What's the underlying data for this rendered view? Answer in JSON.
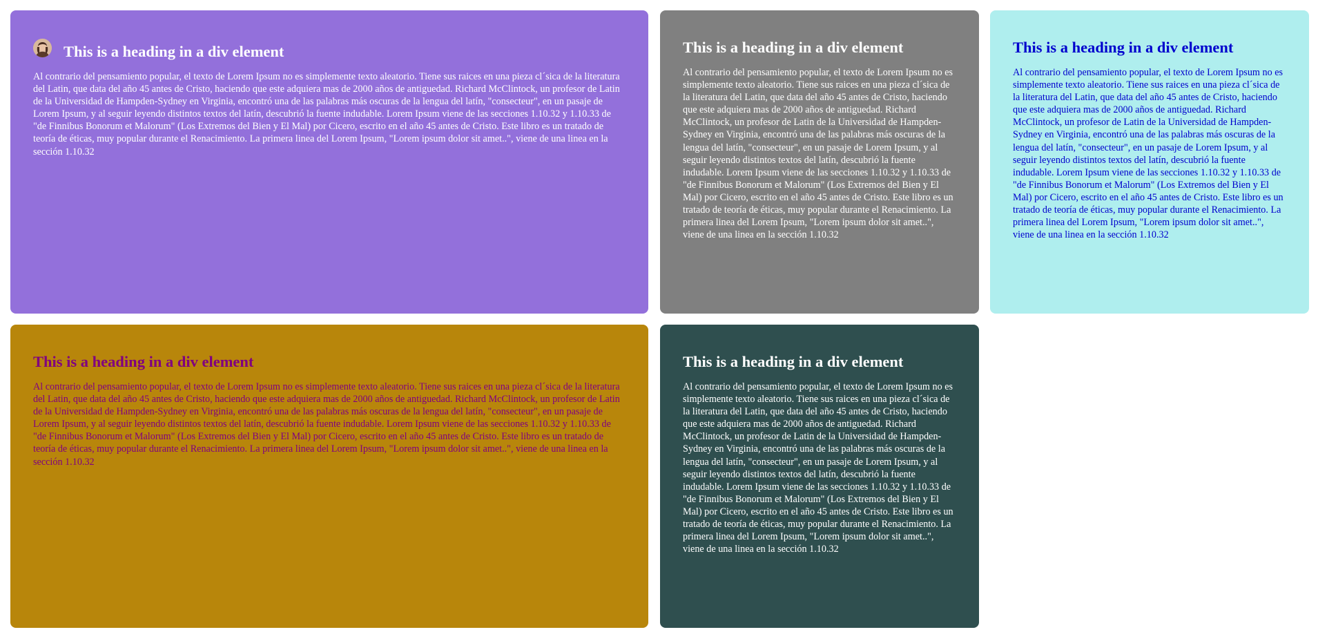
{
  "cards": [
    {
      "heading": "This is a heading in a div element",
      "body": "Al contrario del pensamiento popular, el texto de Lorem Ipsum no es simplemente texto aleatorio. Tiene sus raices en una pieza cl´sica de la literatura del Latin, que data del año 45 antes de Cristo, haciendo que este adquiera mas de 2000 años de antiguedad. Richard McClintock, un profesor de Latin de la Universidad de Hampden-Sydney en Virginia, encontró una de las palabras más oscuras de la lengua del latín, \"consecteur\", en un pasaje de Lorem Ipsum, y al seguir leyendo distintos textos del latín, descubrió la fuente indudable. Lorem Ipsum viene de las secciones 1.10.32 y 1.10.33 de \"de Finnibus Bonorum et Malorum\" (Los Extremos del Bien y El Mal) por Cicero, escrito en el año 45 antes de Cristo. Este libro es un tratado de teoría de éticas, muy popular durante el Renacimiento. La primera linea del Lorem Ipsum, \"Lorem ipsum dolor sit amet..\", viene de una linea en la sección 1.10.32",
      "background": "#9370db",
      "heading_color": "#ffffff",
      "text_color": "#ffffff",
      "has_avatar": true
    },
    {
      "heading": "This is a heading in a div element",
      "body": "Al contrario del pensamiento popular, el texto de Lorem Ipsum no es simplemente texto aleatorio. Tiene sus raices en una pieza cl´sica de la literatura del Latin, que data del año 45 antes de Cristo, haciendo que este adquiera mas de 2000 años de antiguedad. Richard McClintock, un profesor de Latin de la Universidad de Hampden-Sydney en Virginia, encontró una de las palabras más oscuras de la lengua del latín, \"consecteur\", en un pasaje de Lorem Ipsum, y al seguir leyendo distintos textos del latín, descubrió la fuente indudable. Lorem Ipsum viene de las secciones 1.10.32 y 1.10.33 de \"de Finnibus Bonorum et Malorum\" (Los Extremos del Bien y El Mal) por Cicero, escrito en el año 45 antes de Cristo. Este libro es un tratado de teoría de éticas, muy popular durante el Renacimiento. La primera linea del Lorem Ipsum, \"Lorem ipsum dolor sit amet..\", viene de una linea en la sección 1.10.32",
      "background": "#808080",
      "heading_color": "#ffffff",
      "text_color": "#ffffff",
      "has_avatar": false
    },
    {
      "heading": "This is a heading in a div element",
      "body": "Al contrario del pensamiento popular, el texto de Lorem Ipsum no es simplemente texto aleatorio. Tiene sus raices en una pieza cl´sica de la literatura del Latin, que data del año 45 antes de Cristo, haciendo que este adquiera mas de 2000 años de antiguedad. Richard McClintock, un profesor de Latin de la Universidad de Hampden-Sydney en Virginia, encontró una de las palabras más oscuras de la lengua del latín, \"consecteur\", en un pasaje de Lorem Ipsum, y al seguir leyendo distintos textos del latín, descubrió la fuente indudable. Lorem Ipsum viene de las secciones 1.10.32 y 1.10.33 de \"de Finnibus Bonorum et Malorum\" (Los Extremos del Bien y El Mal) por Cicero, escrito en el año 45 antes de Cristo. Este libro es un tratado de teoría de éticas, muy popular durante el Renacimiento. La primera linea del Lorem Ipsum, \"Lorem ipsum dolor sit amet..\", viene de una linea en la sección 1.10.32",
      "background": "#afeeee",
      "heading_color": "#0000cd",
      "text_color": "#0000cd",
      "has_avatar": false
    },
    {
      "heading": "This is a heading in a div element",
      "body": "Al contrario del pensamiento popular, el texto de Lorem Ipsum no es simplemente texto aleatorio. Tiene sus raices en una pieza cl´sica de la literatura del Latin, que data del año 45 antes de Cristo, haciendo que este adquiera mas de 2000 años de antiguedad. Richard McClintock, un profesor de Latin de la Universidad de Hampden-Sydney en Virginia, encontró una de las palabras más oscuras de la lengua del latín, \"consecteur\", en un pasaje de Lorem Ipsum, y al seguir leyendo distintos textos del latín, descubrió la fuente indudable. Lorem Ipsum viene de las secciones 1.10.32 y 1.10.33 de \"de Finnibus Bonorum et Malorum\" (Los Extremos del Bien y El Mal) por Cicero, escrito en el año 45 antes de Cristo. Este libro es un tratado de teoría de éticas, muy popular durante el Renacimiento. La primera linea del Lorem Ipsum, \"Lorem ipsum dolor sit amet..\", viene de una linea en la sección 1.10.32",
      "background": "#b8860b",
      "heading_color": "#800080",
      "text_color": "#800080",
      "has_avatar": false
    },
    {
      "heading": "This is a heading in a div element",
      "body": "Al contrario del pensamiento popular, el texto de Lorem Ipsum no es simplemente texto aleatorio. Tiene sus raices en una pieza cl´sica de la literatura del Latin, que data del año 45 antes de Cristo, haciendo que este adquiera mas de 2000 años de antiguedad. Richard McClintock, un profesor de Latin de la Universidad de Hampden-Sydney en Virginia, encontró una de las palabras más oscuras de la lengua del latín, \"consecteur\", en un pasaje de Lorem Ipsum, y al seguir leyendo distintos textos del latín, descubrió la fuente indudable. Lorem Ipsum viene de las secciones 1.10.32 y 1.10.33 de \"de Finnibus Bonorum et Malorum\" (Los Extremos del Bien y El Mal) por Cicero, escrito en el año 45 antes de Cristo. Este libro es un tratado de teoría de éticas, muy popular durante el Renacimiento. La primera linea del Lorem Ipsum, \"Lorem ipsum dolor sit amet..\", viene de una linea en la sección 1.10.32",
      "background": "#2f4f4f",
      "heading_color": "#ffffff",
      "text_color": "#ffffff",
      "has_avatar": false
    }
  ]
}
